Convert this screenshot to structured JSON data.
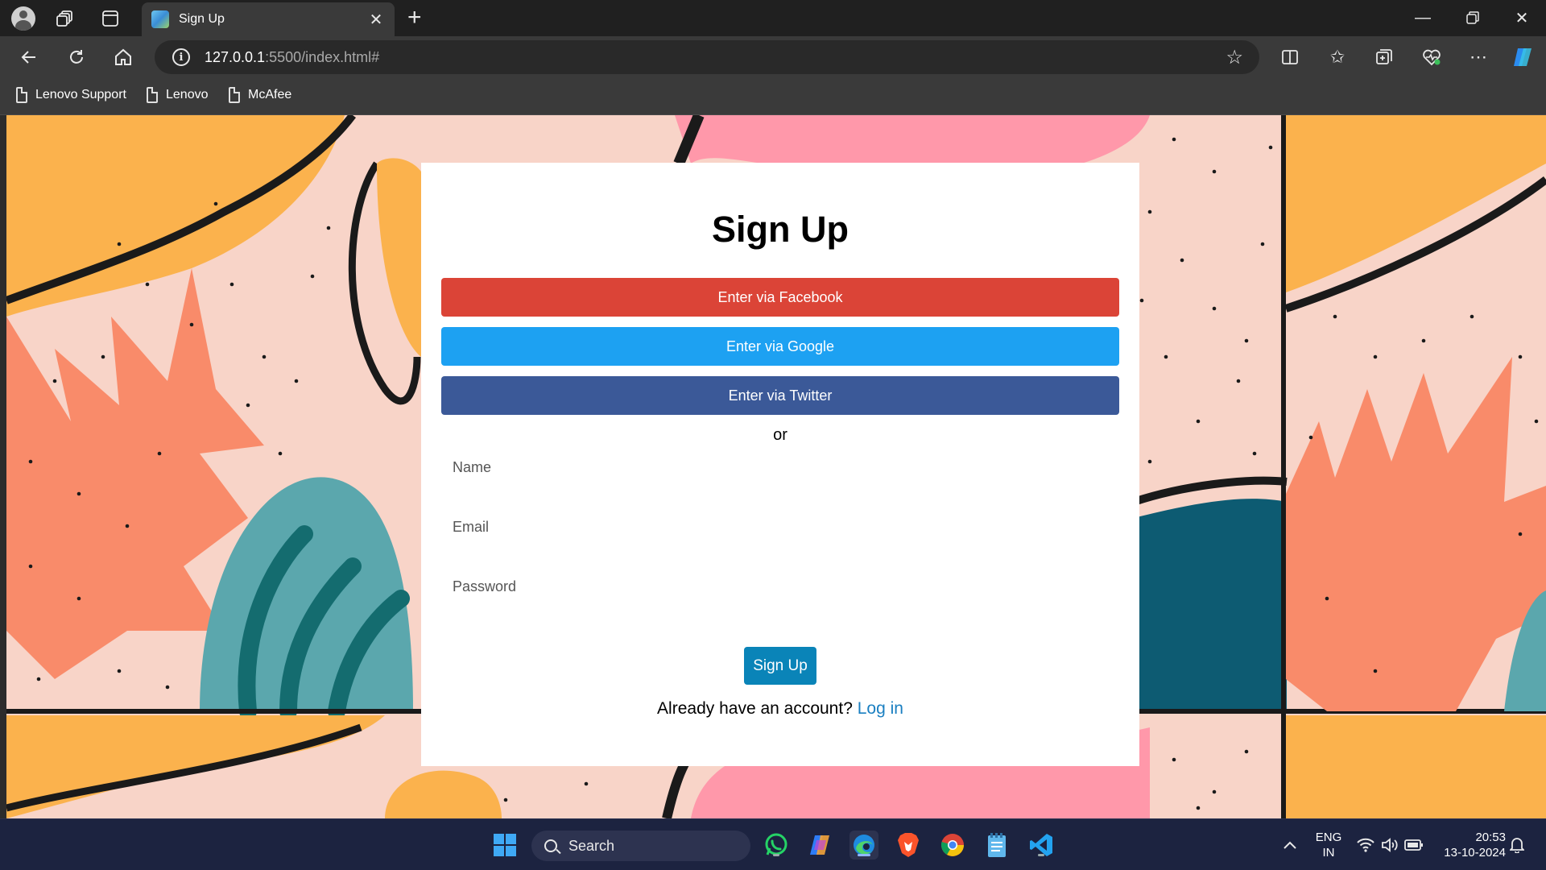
{
  "browser": {
    "tab_title": "Sign Up",
    "url_host": "127.0.0.1",
    "url_rest": ":5500/index.html#",
    "bookmarks": [
      "Lenovo Support",
      "Lenovo",
      "McAfee"
    ]
  },
  "form": {
    "title": "Sign Up",
    "facebook_label": "Enter via Facebook",
    "google_label": "Enter via Google",
    "twitter_label": "Enter via Twitter",
    "or_text": "or",
    "name_placeholder": "Name",
    "email_placeholder": "Email",
    "password_placeholder": "Password",
    "submit_label": "Sign Up",
    "login_prompt": "Already have an account?",
    "login_link": "Log in"
  },
  "colors": {
    "facebook": "#db4437",
    "google": "#1da1f2",
    "twitter": "#3b5998",
    "submit": "#0a84b8",
    "link": "#1a7fc1"
  },
  "taskbar": {
    "search_label": "Search",
    "language": "ENG",
    "region": "IN",
    "time": "20:53",
    "date": "13-10-2024"
  }
}
